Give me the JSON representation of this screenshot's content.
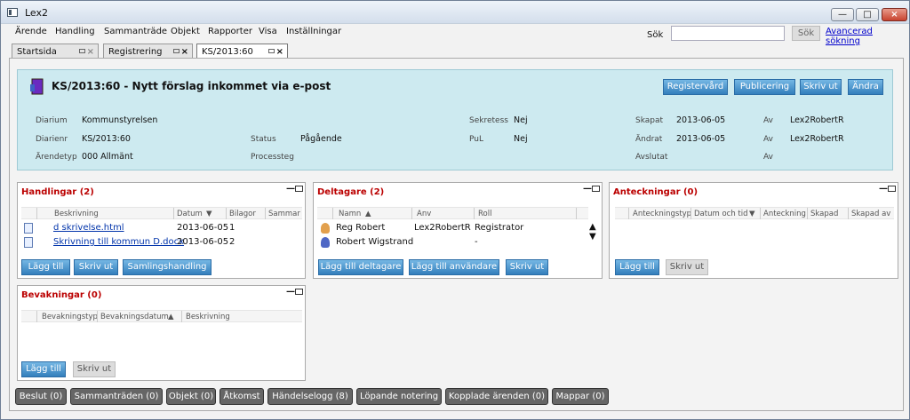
{
  "window": {
    "title": "Lex2",
    "minimize": "—",
    "maximize": "□",
    "close": "×"
  },
  "menu": [
    "Ärende",
    "Handling",
    "Sammanträde",
    "Objekt",
    "Rapporter",
    "Visa",
    "Inställningar"
  ],
  "search": {
    "label": "Sök",
    "button": "Sök",
    "advanced": "Avancerad sökning"
  },
  "tabs": [
    "Startsida",
    "Registrering",
    "KS/2013:60"
  ],
  "case": {
    "title": "KS/2013:60 - Nytt förslag inkommet via e-post",
    "buttons": [
      "Registervård",
      "Publicering",
      "Skriv ut",
      "Ändra"
    ]
  },
  "fields": {
    "diarium_label": "Diarium",
    "diarium": "Kommunstyrelsen",
    "diarienr_label": "Diarienr",
    "diarienr": "KS/2013:60",
    "arendetyp_label": "Ärendetyp",
    "arendetyp": "000 Allmänt",
    "status_label": "Status",
    "status": "Pågående",
    "processteg_label": "Processteg",
    "sekretess_label": "Sekretess",
    "sekretess": "Nej",
    "pul_label": "PuL",
    "pul": "Nej",
    "skapat_label": "Skapat",
    "skapat": "2013-06-05",
    "andrat_label": "Ändrat",
    "andrat": "2013-06-05",
    "avslutat_label": "Avslutat",
    "av1_label": "Av",
    "av1": "Lex2RobertR",
    "av2_label": "Av",
    "av2": "Lex2RobertR",
    "av3_label": "Av"
  },
  "panels": {
    "handlingar": {
      "title": "Handlingar (2)",
      "columns": [
        "Beskrivning",
        "Datum",
        "Bilagor",
        "Sammar"
      ],
      "rows": [
        {
          "desc": "d skrivelse.html",
          "date": "2013-06-05",
          "bilagor": "1"
        },
        {
          "desc": "Skrivning till kommun D.docx",
          "date": "2013-06-05",
          "bilagor": "2"
        }
      ],
      "buttons": [
        "Lägg till",
        "Skriv ut",
        "Samlingshandling"
      ]
    },
    "deltagare": {
      "title": "Deltagare (2)",
      "columns": [
        "Namn",
        "Anv",
        "Roll"
      ],
      "rows": [
        {
          "name": "Reg Robert",
          "anv": "Lex2RobertR",
          "roll": "Registrator"
        },
        {
          "name": "Robert Wigstrand",
          "anv": "",
          "roll": "-"
        }
      ],
      "buttons": [
        "Lägg till deltagare",
        "Lägg till användare",
        "Skriv ut"
      ]
    },
    "anteckningar": {
      "title": "Anteckningar (0)",
      "columns": [
        "Anteckningstyp",
        "Datum och tid",
        "Anteckning",
        "Skapad",
        "Skapad av"
      ],
      "buttons": [
        "Lägg till",
        "Skriv ut"
      ]
    },
    "bevakningar": {
      "title": "Bevakningar (0)",
      "columns": [
        "Bevakningstyp",
        "Bevakningsdatum",
        "Beskrivning"
      ],
      "buttons": [
        "Lägg till",
        "Skriv ut"
      ]
    }
  },
  "bottom_tabs": [
    "Beslut (0)",
    "Sammanträden (0)",
    "Objekt (0)",
    "Åtkomst",
    "Händelselogg (8)",
    "Löpande notering",
    "Kopplade ärenden (0)",
    "Mappar (0)"
  ],
  "colors": {
    "accent": "#3d86c6",
    "panel_title": "#b00000",
    "header_bg": "#cdeaf0"
  }
}
